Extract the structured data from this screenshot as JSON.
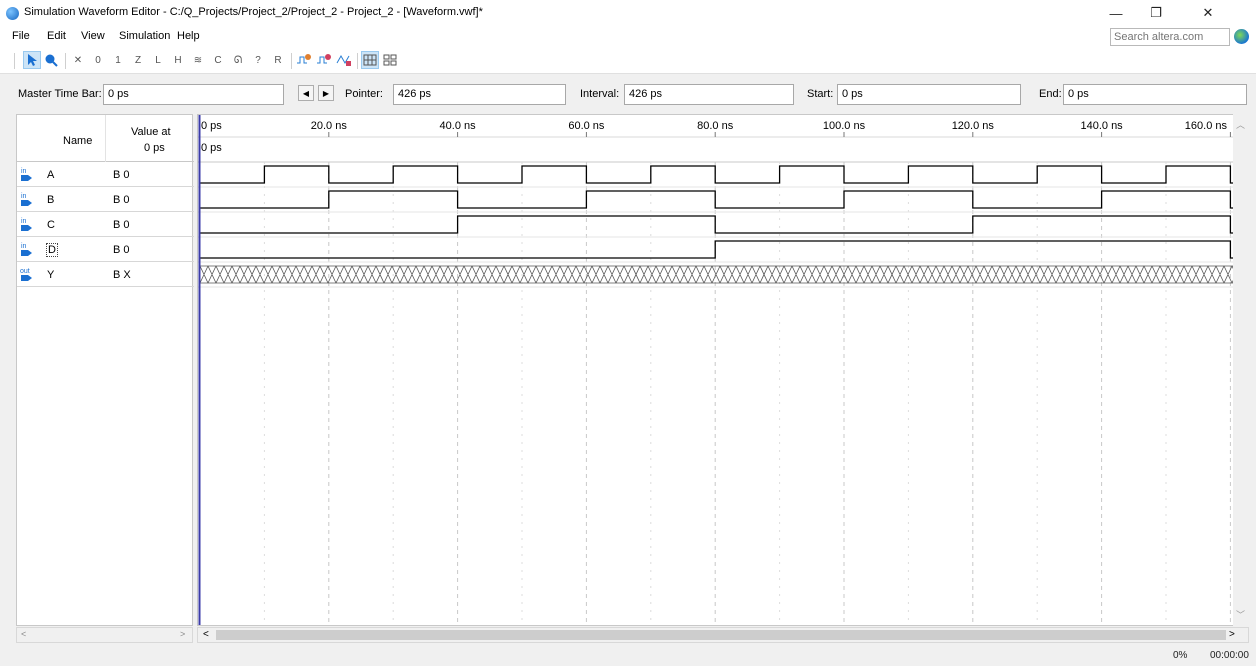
{
  "window": {
    "title": "Simulation Waveform Editor - C:/Q_Projects/Project_2/Project_2 - Project_2 - [Waveform.vwf]*",
    "controls": {
      "minimize": "—",
      "restore": "❐",
      "close": "✕"
    }
  },
  "menu": {
    "items": [
      "File",
      "Edit",
      "View",
      "Simulation",
      "Help"
    ]
  },
  "search": {
    "placeholder": "Search altera.com"
  },
  "timebar": {
    "master_label": "Master Time Bar:",
    "master_value": "0 ps",
    "pointer_label": "Pointer:",
    "pointer_value": "426 ps",
    "interval_label": "Interval:",
    "interval_value": "426 ps",
    "start_label": "Start:",
    "start_value": "0 ps",
    "end_label": "End:",
    "end_value": "0 ps"
  },
  "signals_header": {
    "name": "Name",
    "value_at": "Value at",
    "value_time": "0 ps"
  },
  "signals": [
    {
      "dir": "in",
      "name": "A",
      "value": "B 0"
    },
    {
      "dir": "in",
      "name": "B",
      "value": "B 0"
    },
    {
      "dir": "in",
      "name": "C",
      "value": "B 0"
    },
    {
      "dir": "in",
      "name": "D",
      "value": "B 0"
    },
    {
      "dir": "out",
      "name": "Y",
      "value": "B X"
    }
  ],
  "timeline": {
    "ticks": [
      "0 ps",
      "20.0 ns",
      "40.0 ns",
      "60.0 ns",
      "80.0 ns",
      "100.0 ns",
      "120.0 ns",
      "140.0 ns",
      "160.0 ns"
    ],
    "cursor_label": "0 ps"
  },
  "waves": {
    "A": {
      "period_ns": 20,
      "start_level": 0
    },
    "B": {
      "period_ns": 40,
      "start_level": 0
    },
    "C": {
      "period_ns": 80,
      "start_level": 0
    },
    "D": {
      "period_ns": 160,
      "start_level": 0
    },
    "Y": {
      "unknown": true
    }
  },
  "status": {
    "progress": "0%",
    "elapsed": "00:00:00"
  },
  "colors": {
    "cursor": "#3a3aa8",
    "wave": "#000000",
    "grid": "#c8c8c8"
  }
}
